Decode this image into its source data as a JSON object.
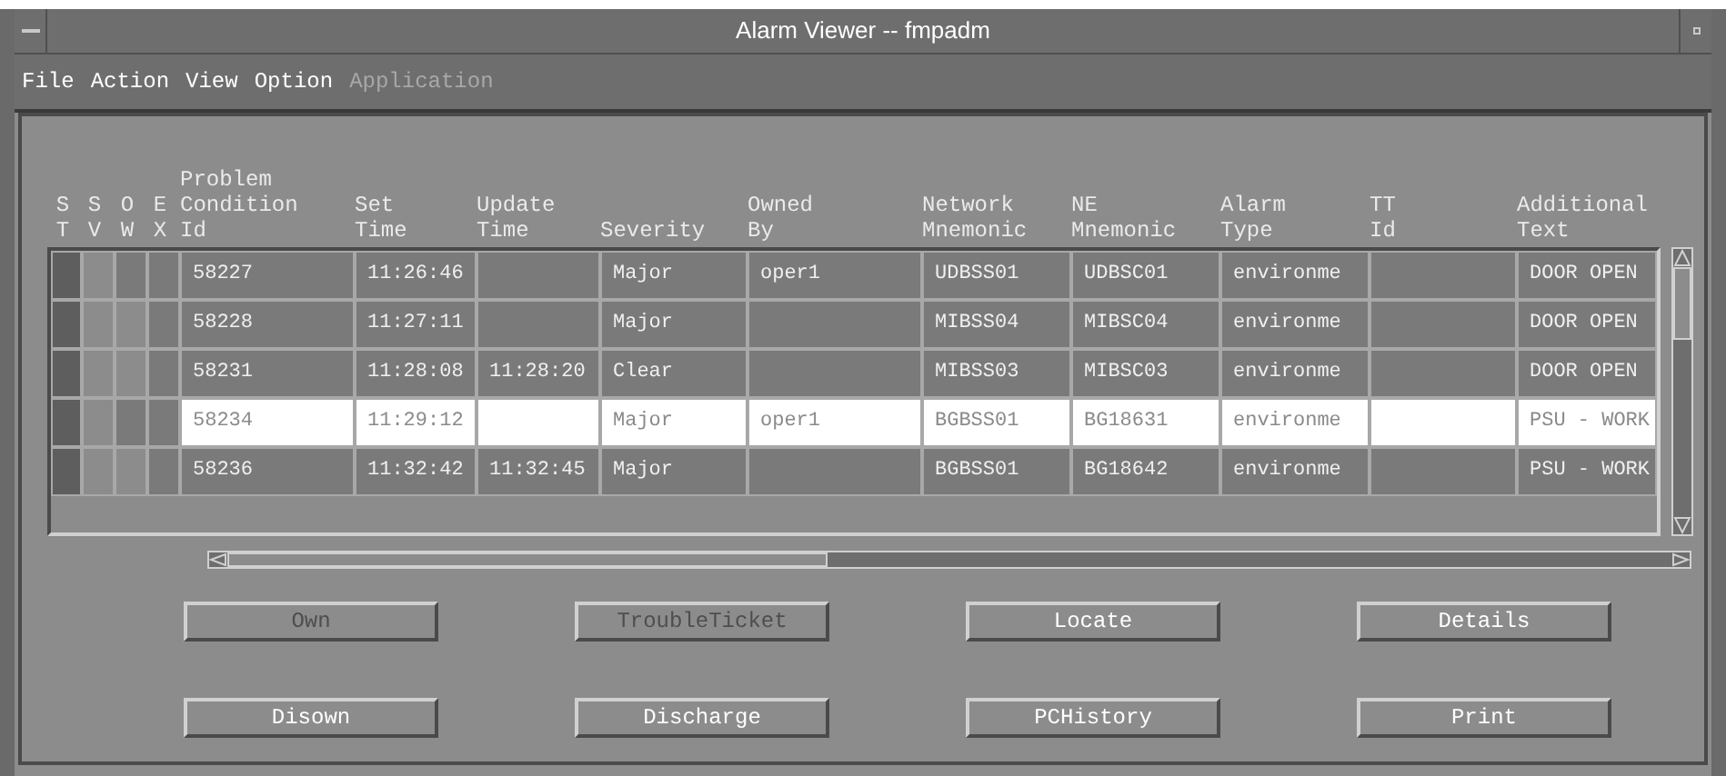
{
  "window": {
    "title": "Alarm Viewer -- fmpadm"
  },
  "menu": [
    {
      "label": "File",
      "disabled": false
    },
    {
      "label": "Action",
      "disabled": false
    },
    {
      "label": "View",
      "disabled": false
    },
    {
      "label": "Option",
      "disabled": false
    },
    {
      "label": "Application",
      "disabled": true
    }
  ],
  "table": {
    "status_columns": [
      "S\nT",
      "S\nV",
      "O\nW",
      "E\nX"
    ],
    "columns": [
      "Problem\nCondition\nId",
      "Set\nTime",
      "Update\nTime",
      "Severity",
      "Owned\nBy",
      "Network\nMnemonic",
      "NE\nMnemonic",
      "Alarm\nType",
      "TT\nId",
      "Additional\nText"
    ],
    "rows": [
      {
        "selected": false,
        "flags": [
          {
            "color": "#5e5e5e"
          },
          {
            "color": "#8c8c8c"
          },
          {
            "color": "#7a7a7a"
          },
          {
            "color": "#7a7a7a"
          }
        ],
        "cells": [
          "58227",
          "11:26:46",
          "",
          "Major",
          "oper1",
          "UDBSS01",
          "UDBSC01",
          "environme",
          "",
          "DOOR OPEN"
        ]
      },
      {
        "selected": false,
        "flags": [
          {
            "color": "#5e5e5e"
          },
          {
            "color": "#8c8c8c"
          },
          {
            "color": "#8c8c8c"
          },
          {
            "color": "#7a7a7a"
          }
        ],
        "cells": [
          "58228",
          "11:27:11",
          "",
          "Major",
          "",
          "MIBSS04",
          "MIBSC04",
          "environme",
          "",
          "DOOR OPEN"
        ]
      },
      {
        "selected": false,
        "flags": [
          {
            "color": "#5e5e5e"
          },
          {
            "color": "#8c8c8c"
          },
          {
            "color": "#8c8c8c"
          },
          {
            "color": "#7a7a7a"
          }
        ],
        "cells": [
          "58231",
          "11:28:08",
          "11:28:20",
          "Clear",
          "",
          "MIBSS03",
          "MIBSC03",
          "environme",
          "",
          "DOOR OPEN"
        ]
      },
      {
        "selected": true,
        "flags": [
          {
            "color": "#5e5e5e"
          },
          {
            "color": "#8c8c8c"
          },
          {
            "color": "#7a7a7a"
          },
          {
            "color": "#7a7a7a"
          }
        ],
        "cells": [
          "58234",
          "11:29:12",
          "",
          "Major",
          "oper1",
          "BGBSS01",
          "BG18631",
          "environme",
          "",
          "PSU - WORK"
        ]
      },
      {
        "selected": false,
        "flags": [
          {
            "color": "#5e5e5e"
          },
          {
            "color": "#8c8c8c"
          },
          {
            "color": "#8c8c8c"
          },
          {
            "color": "#7a7a7a"
          }
        ],
        "cells": [
          "58236",
          "11:32:42",
          "11:32:45",
          "Major",
          "",
          "BGBSS01",
          "BG18642",
          "environme",
          "",
          "PSU - WORK"
        ]
      }
    ]
  },
  "buttons": [
    {
      "label": "Own",
      "disabled": true
    },
    {
      "label": "TroubleTicket",
      "disabled": true
    },
    {
      "label": "Locate",
      "disabled": false
    },
    {
      "label": "Details",
      "disabled": false
    },
    {
      "label": "Disown",
      "disabled": false
    },
    {
      "label": "Discharge",
      "disabled": false
    },
    {
      "label": "PCHistory",
      "disabled": false
    },
    {
      "label": "Print",
      "disabled": false
    }
  ]
}
